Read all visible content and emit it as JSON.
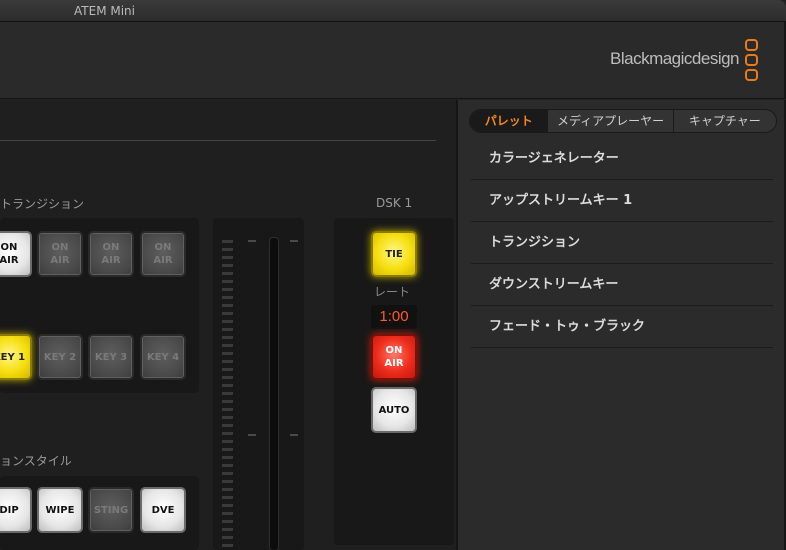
{
  "window": {
    "title": "ATEM Mini"
  },
  "brand": {
    "text": "Blackmagicdesign",
    "accent_color": "#e87b1c"
  },
  "transition": {
    "section_label": "トランジション",
    "on_air_buttons": [
      {
        "label": "ON\nAIR",
        "state": "white"
      },
      {
        "label": "ON\nAIR",
        "state": "off"
      },
      {
        "label": "ON\nAIR",
        "state": "off"
      },
      {
        "label": "ON\nAIR",
        "state": "off"
      }
    ],
    "key_buttons": [
      {
        "label": "KEY 1",
        "state": "yellow"
      },
      {
        "label": "KEY 2",
        "state": "off"
      },
      {
        "label": "KEY 3",
        "state": "off"
      },
      {
        "label": "KEY 4",
        "state": "off"
      }
    ]
  },
  "transition_style": {
    "section_label": "ョンスタイル",
    "buttons": [
      {
        "label": "DIP",
        "state": "white"
      },
      {
        "label": "WIPE",
        "state": "white"
      },
      {
        "label": "STING",
        "state": "off"
      },
      {
        "label": "DVE",
        "state": "white"
      }
    ]
  },
  "dsk": {
    "section_label": "DSK 1",
    "tie_label": "TIE",
    "rate_label": "レート",
    "rate_value": "1:00",
    "on_air_label": "ON\nAIR",
    "auto_label": "AUTO"
  },
  "sidebar": {
    "tabs": [
      {
        "label": "パレット",
        "active": true
      },
      {
        "label": "メディアプレーヤー",
        "active": false
      },
      {
        "label": "キャプチャー",
        "active": false
      }
    ],
    "items": [
      {
        "label": "カラージェネレーター"
      },
      {
        "label": "アップストリームキー 1"
      },
      {
        "label": "トランジション"
      },
      {
        "label": "ダウンストリームキー"
      },
      {
        "label": "フェード・トゥ・ブラック"
      }
    ]
  }
}
